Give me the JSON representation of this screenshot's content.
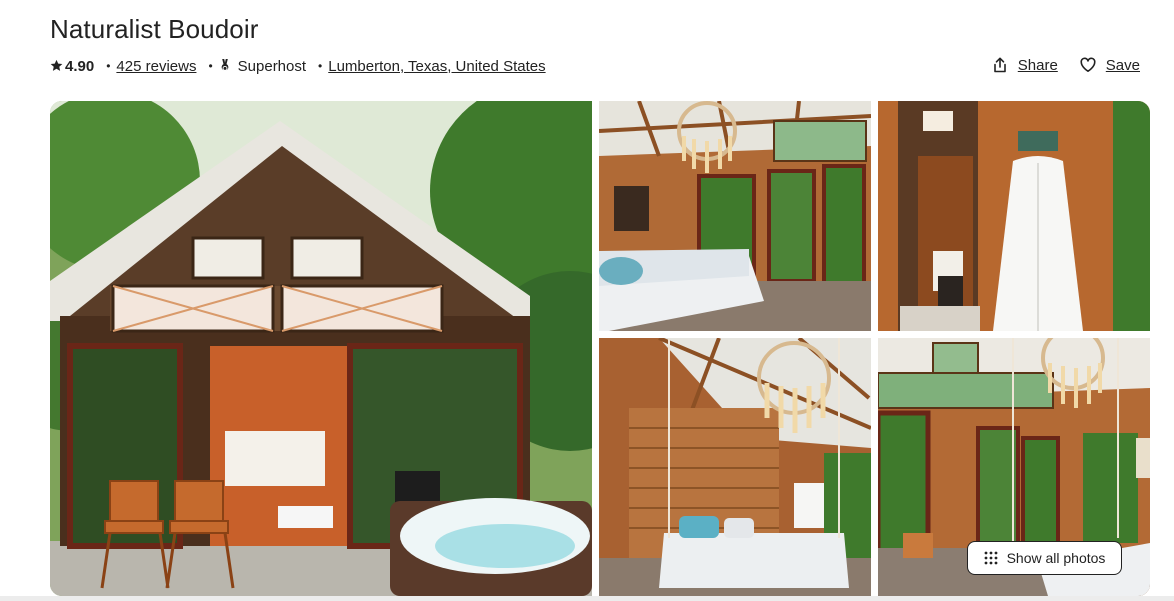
{
  "listing": {
    "title": "Naturalist Boudoir",
    "rating": "4.90",
    "reviews": "425 reviews",
    "host_badge": "Superhost",
    "location": "Lumberton, Texas, United States"
  },
  "actions": {
    "share_label": "Share",
    "save_label": "Save"
  },
  "gallery": {
    "show_all_label": "Show all photos",
    "photos": [
      {
        "id": "main",
        "subject": "cabin exterior with hot tub and chairs"
      },
      {
        "id": "2",
        "subject": "bedroom with chandelier"
      },
      {
        "id": "3",
        "subject": "bathroom with robe"
      },
      {
        "id": "4",
        "subject": "swing bed and chandelier"
      },
      {
        "id": "5",
        "subject": "interior with french doors"
      }
    ]
  },
  "icons": {
    "star": "star-icon",
    "superhost": "medal-icon",
    "share": "share-icon",
    "save": "heart-icon",
    "grid": "grid-icon"
  },
  "colors": {
    "text": "#222222",
    "wood": "#b5652e",
    "foliage": "#3f7a2c"
  }
}
